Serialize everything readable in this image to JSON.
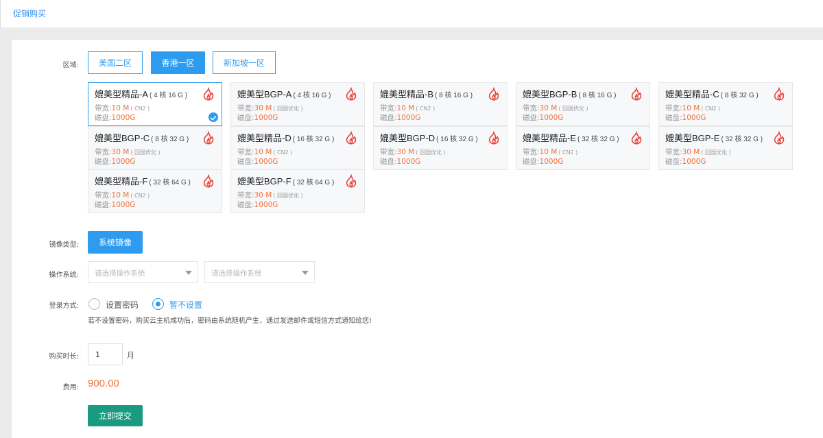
{
  "header": {
    "title": "促销购买"
  },
  "region": {
    "label": "区域:",
    "options": [
      "美国二区",
      "香港一区",
      "新加坡一区"
    ],
    "selected": "香港一区"
  },
  "plans": [
    {
      "name": "媲美型精品-A",
      "spec": "( 4 核 16 G )",
      "bw_label": "带宽:",
      "bw_value": "10 M",
      "bw_note": "( CN2 )",
      "disk_label": "磁盘:",
      "disk_value": "1000G",
      "selected": true
    },
    {
      "name": "媲美型BGP-A",
      "spec": "( 4 核 16 G )",
      "bw_label": "带宽:",
      "bw_value": "30 M",
      "bw_note": "( 回国优化 )",
      "disk_label": "磁盘:",
      "disk_value": "1000G"
    },
    {
      "name": "媲美型精品-B",
      "spec": "( 8 核 16 G )",
      "bw_label": "带宽:",
      "bw_value": "10 M",
      "bw_note": "( CN2 )",
      "disk_label": "磁盘:",
      "disk_value": "1000G"
    },
    {
      "name": "媲美型BGP-B",
      "spec": "( 8 核 16 G )",
      "bw_label": "带宽:",
      "bw_value": "30 M",
      "bw_note": "( 回国优化 )",
      "disk_label": "磁盘:",
      "disk_value": "1000G"
    },
    {
      "name": "媲美型精品-C",
      "spec": "( 8 核 32 G )",
      "bw_label": "带宽:",
      "bw_value": "10 M",
      "bw_note": "( CN2 )",
      "disk_label": "磁盘:",
      "disk_value": "1000G"
    },
    {
      "name": "媲美型BGP-C",
      "spec": "( 8 核 32 G )",
      "bw_label": "带宽:",
      "bw_value": "30 M",
      "bw_note": "( 回国优化 )",
      "disk_label": "磁盘:",
      "disk_value": "1000G"
    },
    {
      "name": "媲美型精品-D",
      "spec": "( 16 核 32 G )",
      "bw_label": "带宽:",
      "bw_value": "10 M",
      "bw_note": "( CN2 )",
      "disk_label": "磁盘:",
      "disk_value": "1000G"
    },
    {
      "name": "媲美型BGP-D",
      "spec": "( 16 核 32 G )",
      "bw_label": "带宽:",
      "bw_value": "30 M",
      "bw_note": "( 回国优化 )",
      "disk_label": "磁盘:",
      "disk_value": "1000G"
    },
    {
      "name": "媲美型精品-E",
      "spec": "( 32 核 32 G )",
      "bw_label": "带宽:",
      "bw_value": "10 M",
      "bw_note": "( CN2 )",
      "disk_label": "磁盘:",
      "disk_value": "1000G"
    },
    {
      "name": "媲美型BGP-E",
      "spec": "( 32 核 32 G )",
      "bw_label": "带宽:",
      "bw_value": "30 M",
      "bw_note": "( 回国优化 )",
      "disk_label": "磁盘:",
      "disk_value": "1000G"
    },
    {
      "name": "媲美型精品-F",
      "spec": "( 32 核 64 G )",
      "bw_label": "带宽:",
      "bw_value": "10 M",
      "bw_note": "( CN2 )",
      "disk_label": "磁盘:",
      "disk_value": "1000G"
    },
    {
      "name": "媲美型BGP-F",
      "spec": "( 32 核 64 G )",
      "bw_label": "带宽:",
      "bw_value": "30 M",
      "bw_note": "( 回国优化 )",
      "disk_label": "磁盘:",
      "disk_value": "1000G"
    }
  ],
  "image_type": {
    "label": "镜像类型:",
    "button": "系统镜像"
  },
  "os": {
    "label": "操作系统:",
    "placeholder1": "请选择操作系统",
    "placeholder2": "请选择操作系统"
  },
  "login": {
    "label": "登录方式:",
    "option_password": "设置密码",
    "option_none": "暂不设置",
    "selected": "暂不设置",
    "hint": "若不设置密码，购买云主机成功后，密码由系统随机产生，通过发送邮件或短信方式通知给您!"
  },
  "duration": {
    "label": "购买时长:",
    "value": "1",
    "unit": "月"
  },
  "cost": {
    "label": "费用:",
    "value": "900.00"
  },
  "submit": {
    "label": "立即提交"
  },
  "colors": {
    "accent": "#2d9bf0",
    "price": "#f0743c",
    "submit": "#1a9b7f",
    "fire": "#e8403a"
  },
  "icons": {
    "plan": "fire-icon",
    "selected": "check-icon",
    "dropdown": "caret-down-icon"
  }
}
